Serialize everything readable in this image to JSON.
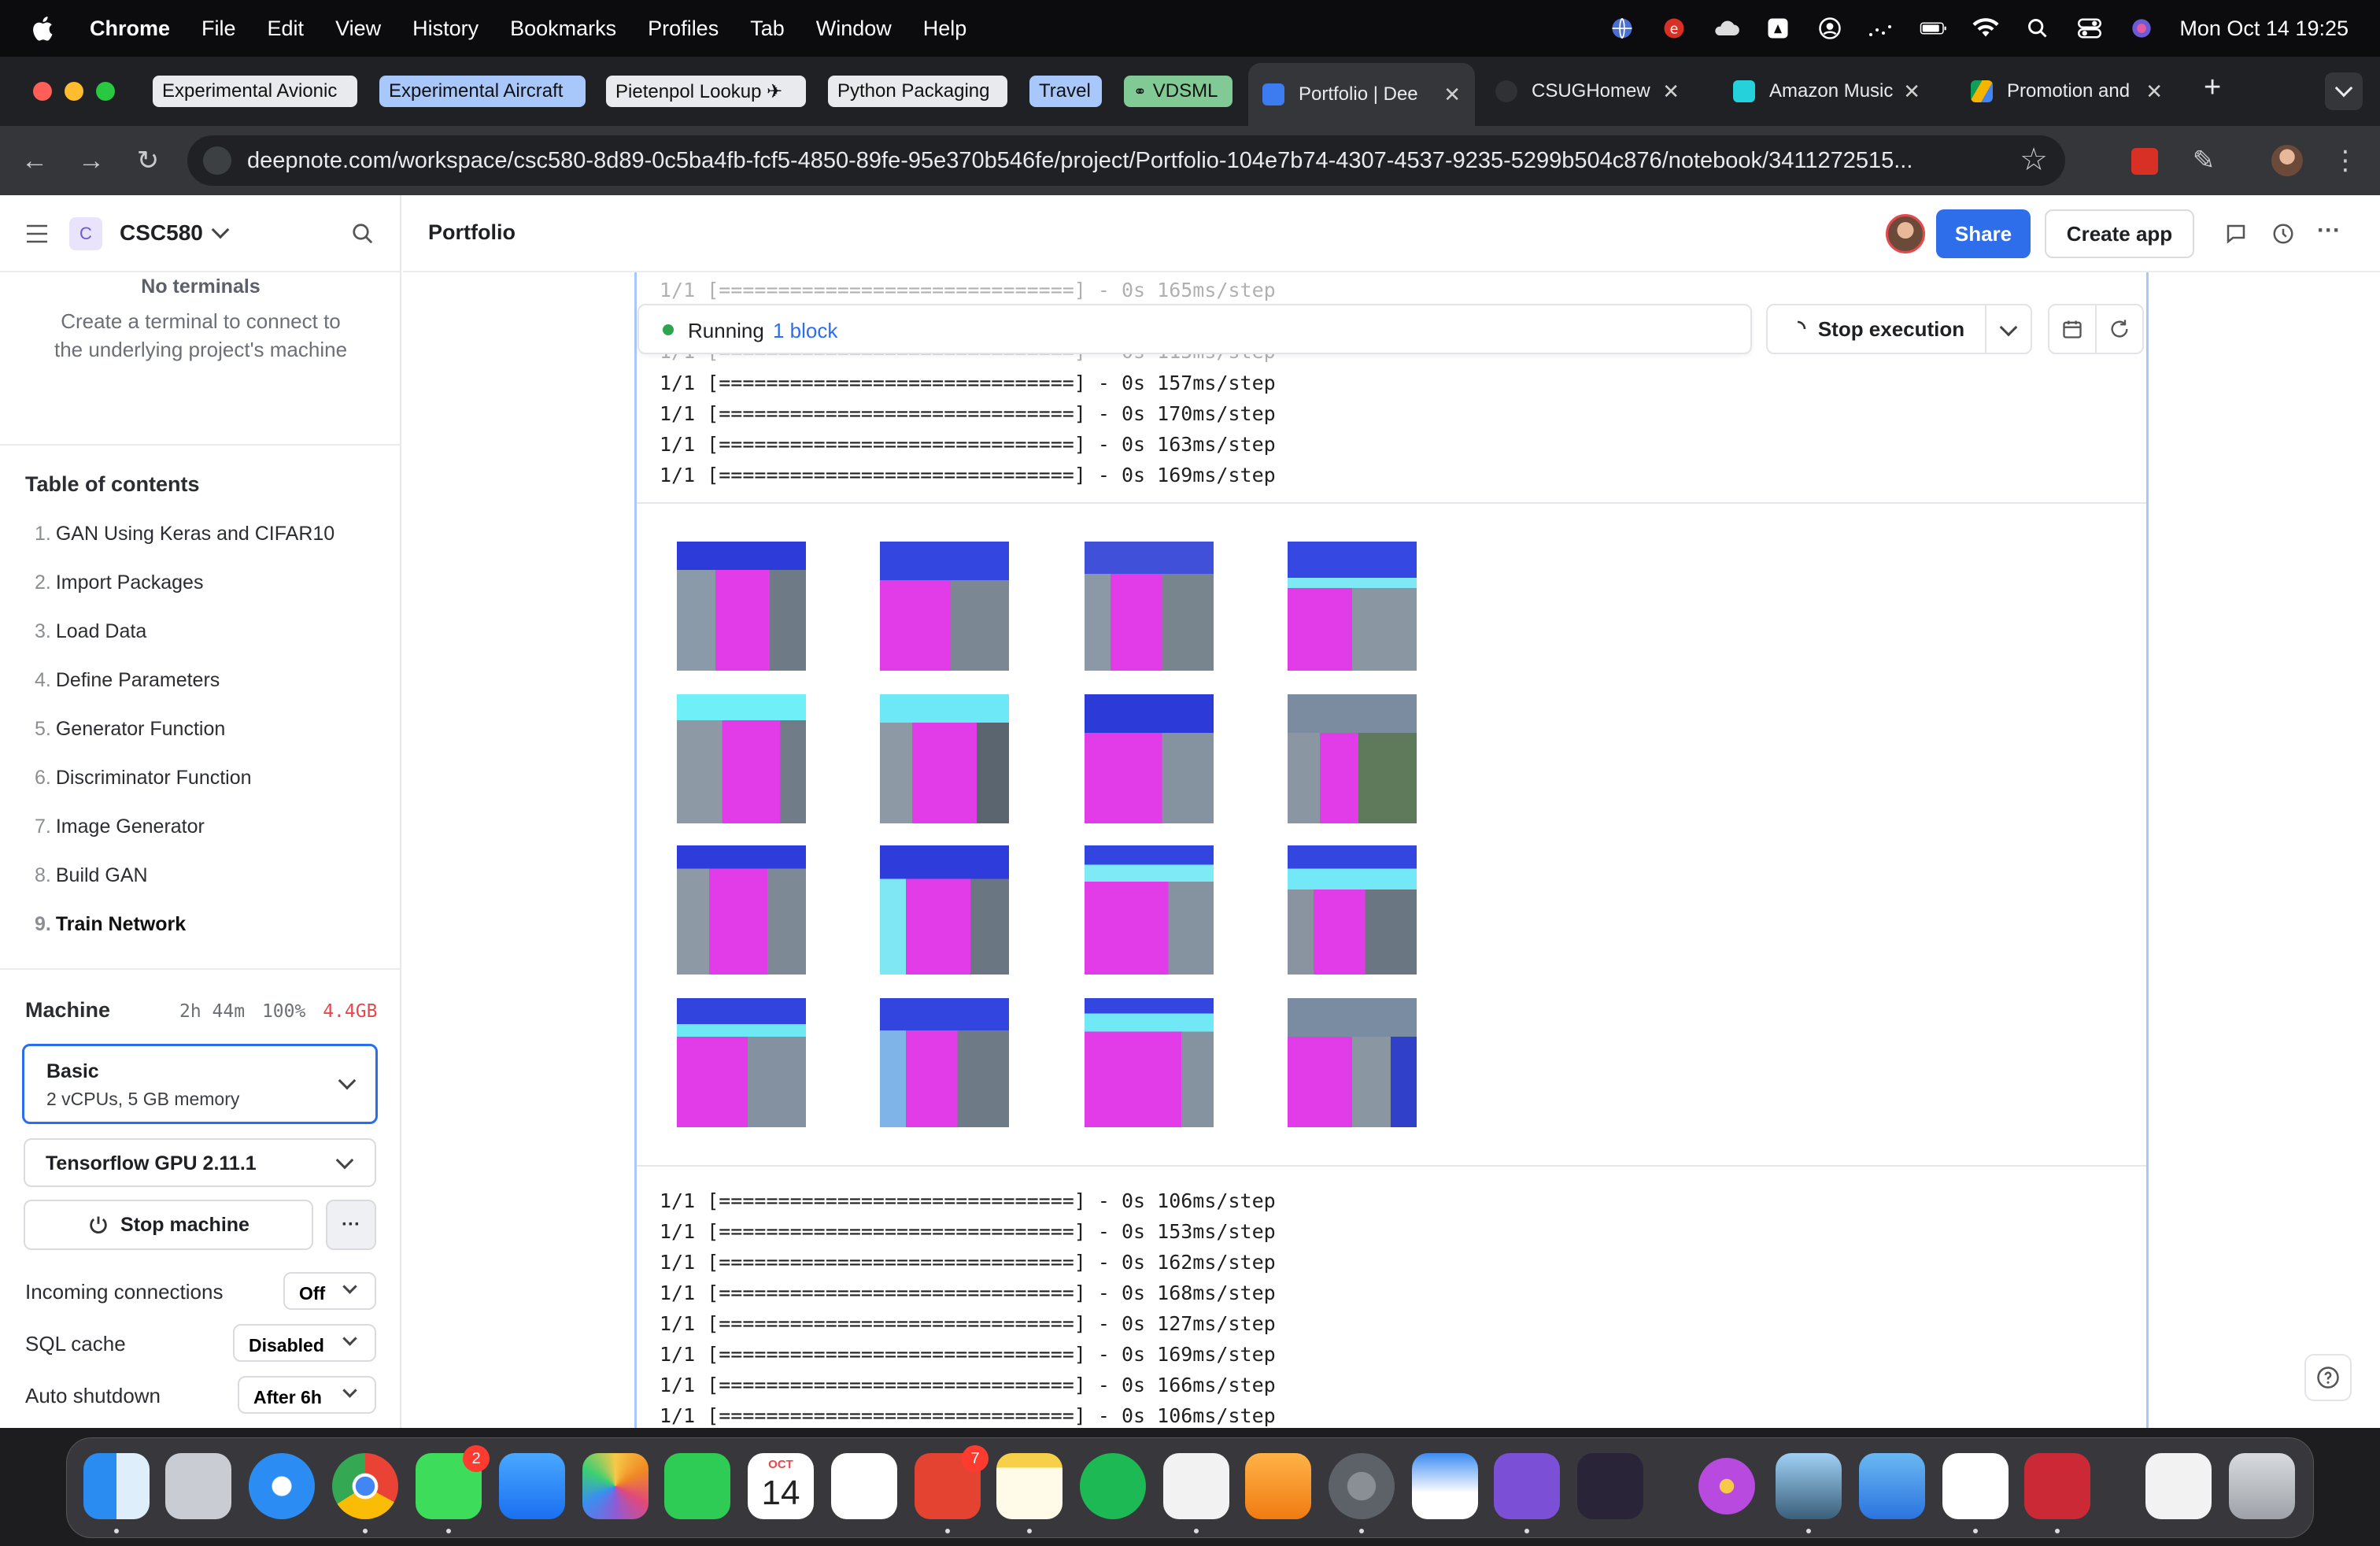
{
  "menubar": {
    "app": "Chrome",
    "items": [
      "File",
      "Edit",
      "View",
      "History",
      "Bookmarks",
      "Profiles",
      "Tab",
      "Window",
      "Help"
    ],
    "clock": "Mon Oct 14  19:25"
  },
  "tabs": {
    "bookmark_chips": [
      {
        "label": "Experimental Avionic",
        "color": "#e8eaed"
      },
      {
        "label": "Experimental Aircraft",
        "color": "#a8c7fa"
      },
      {
        "label": "Pietenpol Lookup ✈",
        "color": "#e8eaed"
      },
      {
        "label": "Python Packaging",
        "color": "#e8eaed"
      },
      {
        "label": "Travel",
        "color": "#a8c7fa"
      },
      {
        "label": "VDSML",
        "color": "#81c995"
      }
    ],
    "open": [
      {
        "label": "Portfolio | Dee",
        "active": true
      },
      {
        "label": "CSUGHomew",
        "active": false
      },
      {
        "label": "Amazon Music",
        "active": false
      },
      {
        "label": "Promotion and",
        "active": false
      }
    ],
    "new_tab": "+"
  },
  "omnibox": {
    "url": "deepnote.com/workspace/csc580-8d89-0c5ba4fb-fcf5-4850-89fe-95e370b546fe/project/Portfolio-104e7b74-4307-4537-9235-5299b504c876/notebook/3411272515..."
  },
  "workspace": {
    "initial": "C",
    "name": "CSC580"
  },
  "terminals": {
    "title": "No terminals",
    "desc": "Create a terminal to connect to the underlying project's machine"
  },
  "toc": {
    "title": "Table of contents",
    "items": [
      {
        "num": "1.",
        "label": "GAN Using Keras and CIFAR10"
      },
      {
        "num": "2.",
        "label": "Import Packages"
      },
      {
        "num": "3.",
        "label": "Load Data"
      },
      {
        "num": "4.",
        "label": "Define Parameters"
      },
      {
        "num": "5.",
        "label": "Generator Function"
      },
      {
        "num": "6.",
        "label": "Discriminator Function"
      },
      {
        "num": "7.",
        "label": "Image Generator"
      },
      {
        "num": "8.",
        "label": "Build GAN"
      },
      {
        "num": "9.",
        "label": "Train Network"
      }
    ]
  },
  "machine": {
    "label": "Machine",
    "uptime": "2h 44m",
    "cpu": "100%",
    "mem": "4.4GB",
    "tier_name": "Basic",
    "tier_desc": "2 vCPUs, 5 GB memory",
    "env": "Tensorflow GPU 2.11.1",
    "stop_label": "Stop machine",
    "more": "···",
    "incoming_label": "Incoming connections",
    "incoming_value": "Off",
    "sql_label": "SQL cache",
    "sql_value": "Disabled",
    "shutdown_label": "Auto shutdown",
    "shutdown_value": "After 6h"
  },
  "topbar": {
    "notebook_title": "Portfolio",
    "share": "Share",
    "create_app": "Create app",
    "more": "···"
  },
  "run_status": {
    "prefix": "Running",
    "link": "1 block",
    "stop": "Stop execution"
  },
  "log_top": [
    "1/1 [==============================] - 0s 165ms/step",
    "1/1 [==============================] - 0s 115ms/step",
    "1/1 [==============================] - 0s 157ms/step",
    "1/1 [==============================] - 0s 170ms/step",
    "1/1 [==============================] - 0s 163ms/step",
    "1/1 [==============================] - 0s 169ms/step"
  ],
  "log_bottom": [
    "1/1 [==============================] - 0s 106ms/step",
    "1/1 [==============================] - 0s 153ms/step",
    "1/1 [==============================] - 0s 162ms/step",
    "1/1 [==============================] - 0s 168ms/step",
    "1/1 [==============================] - 0s 127ms/step",
    "1/1 [==============================] - 0s 169ms/step",
    "1/1 [==============================] - 0s 166ms/step",
    "1/1 [==============================] - 0s 106ms/step"
  ],
  "dock": {
    "apps": [
      "finder",
      "launchpad",
      "safari",
      "chrome",
      "messages",
      "mail",
      "photos",
      "facetime",
      "calendar",
      "reminders",
      "todoist",
      "notes",
      "spotify",
      "preview",
      "pages",
      "system-settings",
      "keynote",
      "github-desktop",
      "obsidian",
      "flower-app",
      "app-store-alt",
      "swift-playgrounds",
      "vscode",
      "zotero",
      "scanner",
      "trash"
    ],
    "messages_badge": "2",
    "todoist_badge": "7",
    "calendar_month": "OCT",
    "calendar_day": "14"
  }
}
